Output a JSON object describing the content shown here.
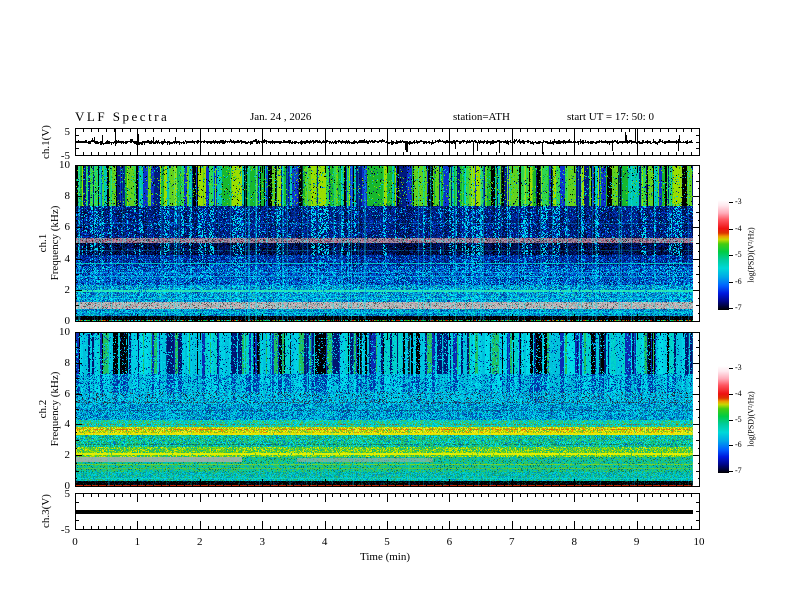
{
  "header": {
    "title": "VLF Spectra",
    "date": "Jan. 24 , 2026",
    "station": "station=ATH",
    "start_ut": "start UT =  17: 50: 0"
  },
  "axes": {
    "time_label": "Time (min)",
    "x_tick_labels": [
      "0",
      "1",
      "2",
      "3",
      "4",
      "5",
      "6",
      "7",
      "8",
      "9",
      "10"
    ],
    "spec_y_tick_labels": [
      "10",
      "8",
      "6",
      "4",
      "2",
      "0"
    ],
    "volt_y_tick_labels": [
      "5",
      "-5"
    ],
    "x_range_min": [
      0,
      10
    ],
    "spec_freq_range_khz": [
      0,
      10
    ],
    "volt_range_v": [
      -5,
      5
    ]
  },
  "panels": {
    "wave1": {
      "ylabel": "ch.1(V)"
    },
    "spec1": {
      "ylabel_ch": "ch.1",
      "ylabel_freq": "Frequency (kHz)"
    },
    "spec2": {
      "ylabel_ch": "ch.2",
      "ylabel_freq": "Frequency (kHz)"
    },
    "wave3": {
      "ylabel": "ch.3(V)"
    }
  },
  "colorbar": {
    "label": "log(PSD)(V²/Hz)",
    "ticks": [
      "-3",
      "-4",
      "-5",
      "-6",
      "-7"
    ],
    "gradient": [
      {
        "pos": 0,
        "color": "#ffffff"
      },
      {
        "pos": 5,
        "color": "#ffe8ee"
      },
      {
        "pos": 12,
        "color": "#ffaab8"
      },
      {
        "pos": 18,
        "color": "#ff5560"
      },
      {
        "pos": 26,
        "color": "#ee1111"
      },
      {
        "pos": 30,
        "color": "#dd3300"
      },
      {
        "pos": 33,
        "color": "#ee9900"
      },
      {
        "pos": 36,
        "color": "#c8d800"
      },
      {
        "pos": 40,
        "color": "#44cc11"
      },
      {
        "pos": 47,
        "color": "#00cc44"
      },
      {
        "pos": 54,
        "color": "#00cc99"
      },
      {
        "pos": 62,
        "color": "#00d8d8"
      },
      {
        "pos": 70,
        "color": "#00a8e8"
      },
      {
        "pos": 78,
        "color": "#0060ff"
      },
      {
        "pos": 85,
        "color": "#0018dd"
      },
      {
        "pos": 92,
        "color": "#000688"
      },
      {
        "pos": 100,
        "color": "#000000"
      }
    ]
  },
  "chart_data": [
    {
      "id": "ch1_waveform",
      "type": "line",
      "panel": "wave1",
      "title": "ch.1 broadband voltage trace",
      "xlim": [
        0,
        10
      ],
      "ylim": [
        -5,
        5
      ],
      "color": "#000000",
      "description": "Dense black noise trace centered on 0 V, ~±1 V envelope with occasional impulsive spikes reaching ±5 V; data ends at ~9.9 min.",
      "seed": 11,
      "sigma_v": 0.3,
      "jitter_v": 0.55,
      "spike_prob": 0.022,
      "spike_v": [
        1.6,
        4.8
      ],
      "down_bias": 0.6,
      "data_frac": 0.989
    },
    {
      "id": "ch1_spectrogram",
      "type": "heatmap",
      "panel": "spec1",
      "title": "ch.1 VLF spectrogram",
      "flim": [
        0,
        10
      ],
      "xlim": [
        0,
        10
      ],
      "description": "0-10 kHz spectrogram: bright green/black sferic stripes above 7.4 kHz, dark blue 4.3-7.4 kHz with cyan streaks, purple-grey hiss band at 5.2 kHz, blue/cyan mottle below 3.6 kHz, grey band near 1 kHz, black below 0.4 kHz.",
      "seed": 23,
      "data_frac": 0.989,
      "streaks": {
        "prob": 0.1,
        "color": "#00e8ff",
        "alpha": 0.4
      },
      "bands": [
        {
          "f": [
            7.4,
            10
          ],
          "stripe": 0.85,
          "scols": [
            "#000000",
            "#001a80",
            "#0d32cc",
            "#17b82e",
            "#5fd21f",
            "#00c9b4",
            "#2fd84f",
            "#9ade00"
          ],
          "px": [
            "#1fae1f",
            "#8fd400",
            "#00c4da",
            "#062a8e",
            "#000000"
          ],
          "pxw": [
            0.3,
            0.2,
            0.2,
            0.15,
            0.15
          ]
        },
        {
          "f": [
            5.35,
            7.4
          ],
          "stripe": 0.3,
          "scols": [
            "#001040",
            "#001f7a",
            "#00dff2"
          ],
          "px": [
            "#001a66",
            "#0029a8",
            "#063fd6",
            "#00c8f0",
            "#000a38"
          ],
          "pxw": [
            0.3,
            0.28,
            0.18,
            0.1,
            0.14
          ]
        },
        {
          "f": [
            5.05,
            5.35
          ],
          "stripe": 0,
          "scols": [],
          "px": [
            "#967c94",
            "#ab95ad",
            "#64526e",
            "#c84e6e",
            "#4fd8d8",
            "#2e2e2e"
          ],
          "pxw": [
            0.34,
            0.24,
            0.2,
            0.08,
            0.06,
            0.08
          ]
        },
        {
          "f": [
            4.25,
            5.05
          ],
          "stripe": 0.32,
          "scols": [
            "#000022",
            "#000e52",
            "#00d8f0"
          ],
          "px": [
            "#000a30",
            "#00135c",
            "#001e88",
            "#000000",
            "#0030b4"
          ],
          "pxw": [
            0.3,
            0.26,
            0.18,
            0.16,
            0.1
          ]
        },
        {
          "f": [
            3.55,
            4.25
          ],
          "stripe": 0.15,
          "scols": [
            "#001a60",
            "#0030a0",
            "#00d0f0"
          ],
          "px": [
            "#0030ae",
            "#004ad8",
            "#001c7a",
            "#00aae8",
            "#000e48"
          ],
          "pxw": [
            0.3,
            0.22,
            0.22,
            0.12,
            0.14
          ]
        },
        {
          "f": [
            2.35,
            3.55
          ],
          "stripe": 0.12,
          "scols": [
            "#002080",
            "#0048c0",
            "#00e0f4"
          ],
          "px": [
            "#0040c4",
            "#0096dc",
            "#0060d4",
            "#00dcf0",
            "#001a70"
          ],
          "pxw": [
            0.28,
            0.2,
            0.2,
            0.14,
            0.18
          ]
        },
        {
          "f": [
            1.3,
            2.35
          ],
          "stripe": 0.1,
          "scols": [
            "#0040a0",
            "#00a0d8",
            "#00e8f8"
          ],
          "px": [
            "#00a8dc",
            "#006cc8",
            "#00e4f4",
            "#0044a8",
            "#28c89c"
          ],
          "pxw": [
            0.3,
            0.24,
            0.2,
            0.16,
            0.1
          ]
        },
        {
          "f": [
            0.85,
            1.3
          ],
          "stripe": 0,
          "scols": [],
          "px": [
            "#b2b2b2",
            "#c6c6c6",
            "#969696",
            "#dc9cac",
            "#6cd4d4",
            "#5a5a5a"
          ],
          "pxw": [
            0.32,
            0.22,
            0.2,
            0.09,
            0.08,
            0.09
          ]
        },
        {
          "f": [
            0.4,
            0.85
          ],
          "stripe": 0,
          "scols": [],
          "px": [
            "#00a4d4",
            "#0064c4",
            "#00d8ec",
            "#003c9c",
            "#00b890"
          ],
          "pxw": [
            0.3,
            0.26,
            0.2,
            0.14,
            0.1
          ]
        },
        {
          "f": [
            0.14,
            0.4
          ],
          "stripe": 0,
          "scols": [],
          "px": [
            "#000000",
            "#000a24",
            "#00123c",
            "#003060"
          ],
          "pxw": [
            0.7,
            0.12,
            0.1,
            0.08
          ]
        },
        {
          "f": [
            0,
            0.14
          ],
          "stripe": 0,
          "scols": [],
          "px": [
            "#00bc44",
            "#c02200",
            "#00d4d4",
            "#000000",
            "#b8a000"
          ],
          "pxw": [
            0.3,
            0.2,
            0.18,
            0.2,
            0.12
          ]
        }
      ],
      "hlines": [
        {
          "f": 6.3,
          "color": "#00d0f0",
          "alpha": 0.3,
          "h": 1,
          "dash": 0.8
        },
        {
          "f": 4.6,
          "color": "#00c0f0",
          "alpha": 0.3,
          "h": 1,
          "dash": 0.85
        },
        {
          "f": 3.75,
          "color": "#00f0c8",
          "alpha": 0.75,
          "h": 1,
          "dash": 0.95
        },
        {
          "f": 3.2,
          "color": "#00e0f4",
          "alpha": 0.4,
          "h": 1,
          "dash": 0.9
        },
        {
          "f": 2.9,
          "color": "#00e0f4",
          "alpha": 0.5,
          "h": 1,
          "dash": 0.9
        },
        {
          "f": 2.05,
          "color": "#30f0b0",
          "alpha": 0.85,
          "h": 2,
          "dash": 0.97
        },
        {
          "f": 1.55,
          "color": "#00e8f8",
          "alpha": 0.45,
          "h": 1,
          "dash": 0.9
        },
        {
          "f": 0.62,
          "color": "#00e8f8",
          "alpha": 0.5,
          "h": 1,
          "dash": 0.9
        }
      ],
      "segs": []
    },
    {
      "id": "ch2_spectrogram",
      "type": "heatmap",
      "panel": "spec2",
      "title": "ch.2 VLF spectrogram",
      "flim": [
        0,
        10
      ],
      "xlim": [
        0,
        10
      ],
      "description": "0-10 kHz spectrogram: cyan background with navy/black sferic stripes above 7.3 kHz, cyan/blue mottle 4.3-7.3 kHz, yellow hiss band 3.4-3.9 kHz with orange dashes, green/yellow bands near 2.2 kHz, grey interference segments near 1.7 kHz, black with red line below 0.4 kHz.",
      "seed": 37,
      "data_frac": 0.989,
      "streaks": {
        "prob": 0.07,
        "color": "#00e8ff",
        "alpha": 0.3
      },
      "bands": [
        {
          "f": [
            7.3,
            10
          ],
          "stripe": 0.8,
          "scols": [
            "#00c2dc",
            "#00dce8",
            "#001670",
            "#000000",
            "#0a2cb4",
            "#00d2c8",
            "#1fc060",
            "#00cfe4"
          ],
          "px": [
            "#00bcd8",
            "#00dcec",
            "#0040b8",
            "#001a60"
          ],
          "pxw": [
            0.4,
            0.25,
            0.2,
            0.15
          ]
        },
        {
          "f": [
            6.1,
            7.3
          ],
          "stripe": 0.45,
          "scols": [
            "#00bcd8",
            "#0038ac",
            "#00dcec"
          ],
          "px": [
            "#00b4d4",
            "#005cc4",
            "#00dcec",
            "#002a94"
          ],
          "pxw": [
            0.38,
            0.24,
            0.22,
            0.16
          ]
        },
        {
          "f": [
            5.35,
            6.1
          ],
          "stripe": 0.2,
          "scols": [
            "#00b4d8",
            "#0048b0",
            "#00dcec"
          ],
          "px": [
            "#00bcdc",
            "#00dcec",
            "#0078cc",
            "#2a5a7a",
            "#16283c"
          ],
          "pxw": [
            0.36,
            0.22,
            0.22,
            0.1,
            0.1
          ]
        },
        {
          "f": [
            4.35,
            5.35
          ],
          "stripe": 0.15,
          "scols": [
            "#0090c8",
            "#00c8e0",
            "#0050b0"
          ],
          "px": [
            "#00b4dc",
            "#0068c4",
            "#00dcec",
            "#003c9c",
            "#008c8c"
          ],
          "pxw": [
            0.34,
            0.24,
            0.22,
            0.1,
            0.1
          ]
        },
        {
          "f": [
            3.85,
            4.35
          ],
          "stripe": 0,
          "scols": [],
          "px": [
            "#00ccbc",
            "#2cc878",
            "#00dcec",
            "#58bc3c",
            "#00a4c8"
          ],
          "pxw": [
            0.3,
            0.24,
            0.2,
            0.14,
            0.12
          ]
        },
        {
          "f": [
            3.38,
            3.85
          ],
          "stripe": 0,
          "scols": [],
          "px": [
            "#d4dc00",
            "#eeee20",
            "#9ccc00",
            "#f08800",
            "#58bc3c"
          ],
          "pxw": [
            0.34,
            0.22,
            0.2,
            0.1,
            0.14
          ]
        },
        {
          "f": [
            2.55,
            3.38
          ],
          "stripe": 0,
          "scols": [],
          "px": [
            "#2cc46c",
            "#00cc9c",
            "#00dcec",
            "#1c9c5c",
            "#0078c0"
          ],
          "pxw": [
            0.3,
            0.24,
            0.2,
            0.14,
            0.12
          ]
        },
        {
          "f": [
            1.95,
            2.55
          ],
          "stripe": 0,
          "scols": [],
          "px": [
            "#58cc2c",
            "#9cdc00",
            "#2cbc5c",
            "#dce400",
            "#00bc8c"
          ],
          "pxw": [
            0.28,
            0.24,
            0.2,
            0.16,
            0.12
          ]
        },
        {
          "f": [
            0.95,
            1.95
          ],
          "stripe": 0,
          "scols": [],
          "px": [
            "#1cbc7c",
            "#00ccac",
            "#3cc84c",
            "#00acc8",
            "#0c7c5c"
          ],
          "pxw": [
            0.28,
            0.24,
            0.2,
            0.16,
            0.12
          ]
        },
        {
          "f": [
            0.38,
            0.95
          ],
          "stripe": 0,
          "scols": [],
          "px": [
            "#00c4ac",
            "#00ccdc",
            "#2cb46c",
            "#008cbc",
            "#00a08c"
          ],
          "pxw": [
            0.3,
            0.24,
            0.2,
            0.14,
            0.12
          ]
        },
        {
          "f": [
            0.16,
            0.38
          ],
          "stripe": 0,
          "scols": [],
          "px": [
            "#000000",
            "#000e2c",
            "#001c3c",
            "#0a3c2c"
          ],
          "pxw": [
            0.66,
            0.14,
            0.1,
            0.1
          ]
        },
        {
          "f": [
            0,
            0.16
          ],
          "stripe": 0,
          "scols": [],
          "px": [
            "#a81400",
            "#cc3000",
            "#000000",
            "#00989c",
            "#0a7c28"
          ],
          "pxw": [
            0.3,
            0.2,
            0.22,
            0.14,
            0.14
          ]
        }
      ],
      "hlines": [
        {
          "f": 5.5,
          "color": "#303030",
          "alpha": 0.55,
          "h": 1,
          "dash": 0.5
        },
        {
          "f": 5.0,
          "color": "#0c2c50",
          "alpha": 0.5,
          "h": 1,
          "dash": 0.6
        },
        {
          "f": 4.05,
          "color": "#c02000",
          "alpha": 0.55,
          "h": 1,
          "dash": 0.35
        },
        {
          "f": 3.72,
          "color": "#f05000",
          "alpha": 0.8,
          "h": 1,
          "dash": 0.5
        },
        {
          "f": 3.5,
          "color": "#f4ea00",
          "alpha": 0.8,
          "h": 2,
          "dash": 0.95
        },
        {
          "f": 2.8,
          "color": "#0c3c3c",
          "alpha": 0.5,
          "h": 1,
          "dash": 0.6
        },
        {
          "f": 2.2,
          "color": "#eef200",
          "alpha": 0.9,
          "h": 2,
          "dash": 0.97
        },
        {
          "f": 1.5,
          "color": "#a8dc00",
          "alpha": 0.6,
          "h": 1,
          "dash": 0.9
        },
        {
          "f": 1.2,
          "color": "#8cd000",
          "alpha": 0.5,
          "h": 1,
          "dash": 0.85
        },
        {
          "f": 0.6,
          "color": "#00e4dc",
          "alpha": 0.5,
          "h": 1,
          "dash": 0.9
        },
        {
          "f": 0.1,
          "color": "#c02000",
          "alpha": 0.95,
          "h": 1,
          "dash": 1
        }
      ],
      "segs": [
        {
          "f": [
            1.62,
            1.95
          ],
          "x": [
            0,
            0.27
          ],
          "color": "#b4b0ac",
          "alpha": 0.8
        },
        {
          "f": [
            1.62,
            1.85
          ],
          "x": [
            0.36,
            0.58
          ],
          "color": "#b4b0ac",
          "alpha": 0.55
        }
      ]
    },
    {
      "id": "ch3_waveform",
      "type": "line",
      "panel": "wave3",
      "title": "ch.3 voltage trace",
      "xlim": [
        0,
        10
      ],
      "ylim": [
        -5,
        5
      ],
      "color": "#000000",
      "description": "Flat thick black line at 0 V across the whole record (no signal), ending at ~9.9 min.",
      "value": 0,
      "thickness_px": 4,
      "data_frac": 0.989
    }
  ]
}
